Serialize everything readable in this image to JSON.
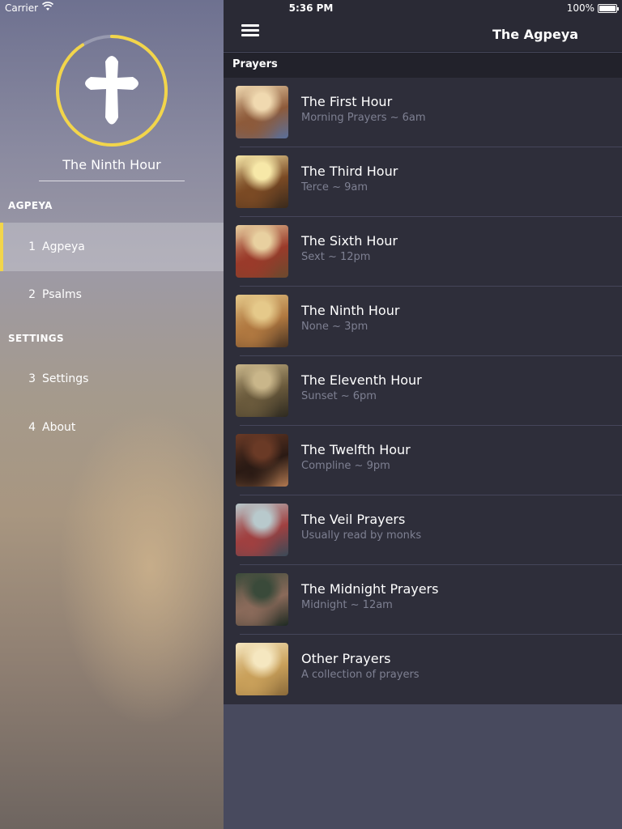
{
  "status_bar": {
    "carrier": "Carrier",
    "time": "5:36 PM",
    "battery": "100%"
  },
  "sidebar": {
    "current_hour": "The Ninth Hour",
    "accent_color": "#f2d54a",
    "sections": [
      {
        "header": "AGPEYA",
        "items": [
          {
            "num": "1",
            "label": "Agpeya",
            "active": true
          },
          {
            "num": "2",
            "label": "Psalms",
            "active": false
          }
        ]
      },
      {
        "header": "SETTINGS",
        "items": [
          {
            "num": "3",
            "label": "Settings",
            "active": false
          },
          {
            "num": "4",
            "label": "About",
            "active": false
          }
        ]
      }
    ]
  },
  "navbar": {
    "title": "The Agpeya",
    "menu_icon": "hamburger-icon"
  },
  "list_section": "Prayers",
  "prayers": [
    {
      "title": "The First Hour",
      "subtitle": "Morning Prayers ~ 6am",
      "thumb": [
        "#f0d9b0",
        "#8d5a3a",
        "#5a6f9a"
      ]
    },
    {
      "title": "The Third Hour",
      "subtitle": "Terce ~ 9am",
      "thumb": [
        "#f7e8a8",
        "#7b4a24",
        "#3a2a1c"
      ]
    },
    {
      "title": "The Sixth Hour",
      "subtitle": "Sext ~ 12pm",
      "thumb": [
        "#e8d0a0",
        "#9a3a2a",
        "#6b4a2e"
      ]
    },
    {
      "title": "The Ninth Hour",
      "subtitle": "None ~ 3pm",
      "thumb": [
        "#e5c98a",
        "#b07840",
        "#4a3422"
      ]
    },
    {
      "title": "The Eleventh Hour",
      "subtitle": "Sunset ~ 6pm",
      "thumb": [
        "#c9b68a",
        "#6a5a3c",
        "#2e2a20"
      ]
    },
    {
      "title": "The Twelfth Hour",
      "subtitle": "Compline ~ 9pm",
      "thumb": [
        "#6a3a26",
        "#2a1a14",
        "#b07850"
      ]
    },
    {
      "title": "The Veil Prayers",
      "subtitle": "Usually read by monks",
      "thumb": [
        "#b8c9cc",
        "#a04040",
        "#3a4a58"
      ]
    },
    {
      "title": "The Midnight Prayers",
      "subtitle": "Midnight ~ 12am",
      "thumb": [
        "#3a4a3a",
        "#8a6a5a",
        "#1e2a22"
      ]
    },
    {
      "title": "Other Prayers",
      "subtitle": "A collection of prayers",
      "thumb": [
        "#f5e7c0",
        "#c9a05a",
        "#8a6a3a"
      ]
    }
  ]
}
